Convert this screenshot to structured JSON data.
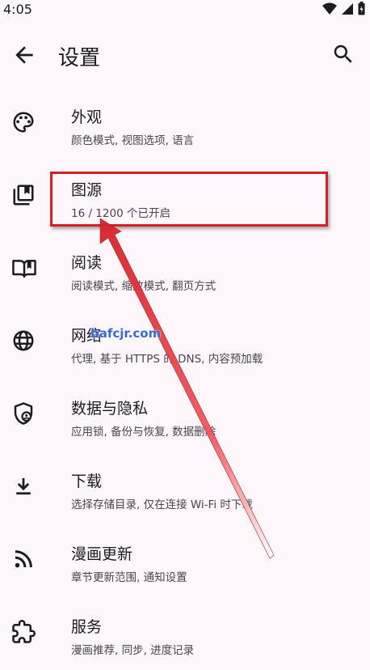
{
  "status": {
    "time": "4:05"
  },
  "header": {
    "title": "设置"
  },
  "items": [
    {
      "label": "外观",
      "sub": "颜色模式, 视图选项, 语言",
      "icon": "palette-icon"
    },
    {
      "label": "图源",
      "sub": "16 / 1200 个已开启",
      "icon": "library-icon"
    },
    {
      "label": "阅读",
      "sub": "阅读模式, 缩放模式, 翻页方式",
      "icon": "book-open-icon"
    },
    {
      "label": "网络",
      "sub": "代理, 基于 HTTPS 的 DNS, 内容预加载",
      "icon": "globe-icon"
    },
    {
      "label": "数据与隐私",
      "sub": "应用锁, 备份与恢复, 数据删除",
      "icon": "shield-user-icon"
    },
    {
      "label": "下载",
      "sub": "选择存储目录, 仅在连接 Wi-Fi 时下载",
      "icon": "download-icon"
    },
    {
      "label": "漫画更新",
      "sub": "章节更新范围, 通知设置",
      "icon": "rss-icon"
    },
    {
      "label": "服务",
      "sub": "漫画推荐, 同步, 进度记录",
      "icon": "puzzle-icon"
    }
  ],
  "watermark": "bafcjr.com",
  "colors": {
    "background": "#fdf7fc",
    "highlight": "#d62027"
  }
}
